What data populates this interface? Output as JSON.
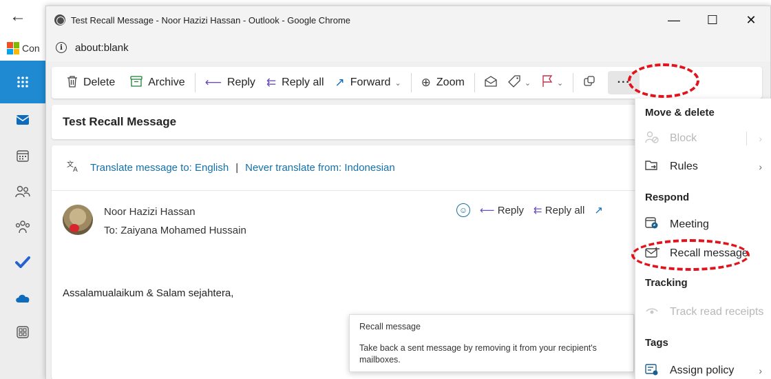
{
  "background": {
    "back_arrow": "←",
    "tab_text": "Con"
  },
  "rail": {
    "items": [
      "apps-icon",
      "mail-icon",
      "calendar-icon",
      "people-icon",
      "groups-icon",
      "todo-icon",
      "onedrive-icon",
      "more-apps-icon"
    ]
  },
  "window": {
    "title": "Test Recall Message - Noor Hazizi Hassan - Outlook - Google Chrome",
    "minimize": "—",
    "maximize": "☐",
    "close": "✕",
    "address": "about:blank"
  },
  "toolbar": {
    "delete": "Delete",
    "archive": "Archive",
    "reply": "Reply",
    "reply_all": "Reply all",
    "forward": "Forward",
    "zoom": "Zoom",
    "more": "···"
  },
  "message": {
    "subject": "Test Recall Message",
    "translate_to": "Translate message to: English",
    "separator": "|",
    "never_translate": "Never translate from: Indonesian",
    "sender": "Noor Hazizi Hassan",
    "to_label": "To:",
    "to": "Zaiyana Mohamed Hussain",
    "reply": "Reply",
    "reply_all": "Reply all",
    "body": "Assalamualaikum & Salam sejahtera,"
  },
  "tooltip": {
    "title": "Recall message",
    "description": "Take back a sent message by removing it from your recipient's mailboxes."
  },
  "menu": {
    "section_move": "Move & delete",
    "block": "Block",
    "rules": "Rules",
    "section_respond": "Respond",
    "meeting": "Meeting",
    "recall": "Recall message",
    "section_tracking": "Tracking",
    "track": "Track read receipts",
    "section_tags": "Tags",
    "assign_policy": "Assign policy"
  },
  "colors": {
    "accent": "#0f6cbd",
    "annotation": "#e1141e",
    "rail_selected": "#1f8ad2"
  }
}
